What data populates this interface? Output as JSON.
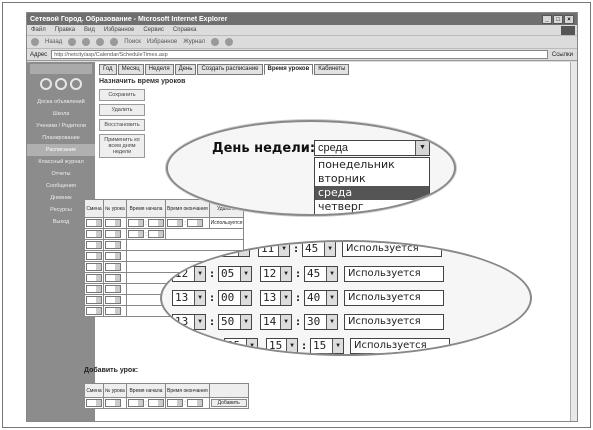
{
  "window": {
    "title": "Сетевой Город. Образование - Microsoft Internet Explorer",
    "controls": [
      "_",
      "□",
      "×"
    ]
  },
  "menubar": [
    "Файл",
    "Правка",
    "Вид",
    "Избранное",
    "Сервис",
    "Справка"
  ],
  "toolbar": [
    "Назад",
    "Поиск",
    "Избранное",
    "Журнал"
  ],
  "address": {
    "label": "Адрес",
    "value": "http://netcity/asp/Calendar/ScheduleTimes.asp",
    "go": "Ссылки"
  },
  "sidebar": {
    "items": [
      "Доска объявлений",
      "Школа",
      "Ученики / Родители",
      "Планирование",
      "Расписание",
      "Классный журнал",
      "Отчеты",
      "Сообщения",
      "Дневник",
      "Ресурсы",
      "Выход"
    ]
  },
  "tabs": [
    "Год",
    "Месяц",
    "Неделя",
    "День",
    "Создать расписание",
    "Время уроков",
    "Кабинеты"
  ],
  "main": {
    "title": "Назначить время уроков",
    "buttons": [
      "Сохранить",
      "Удалить",
      "Восстановить",
      "Применить ко всем дням недели"
    ]
  },
  "dayselect": {
    "label": "День недели:",
    "value": "среда",
    "options": [
      "понедельник",
      "вторник",
      "среда",
      "четверг"
    ]
  },
  "table": {
    "headers": [
      "Смена",
      "№ урока",
      "Время начала",
      "Время окончания",
      "Удалить"
    ],
    "deleteLabel": "Используется"
  },
  "zoomRows": [
    {
      "sh": "12",
      "sm": "05",
      "eh": "12",
      "em": "45",
      "status": "Используется"
    },
    {
      "sh": "13",
      "sm": "00",
      "eh": "13",
      "em": "40",
      "status": "Используется"
    },
    {
      "sh": "13",
      "sm": "50",
      "eh": "14",
      "em": "30",
      "status": "Используется"
    },
    {
      "sh": "",
      "sm": "35",
      "eh": "15",
      "em": "15",
      "status": "Используется"
    }
  ],
  "topZoomRow": {
    "sh": "11",
    "sm": "05",
    "eh": "11",
    "em": "45",
    "status": "Используется"
  },
  "addSection": {
    "title": "Добавить урок:",
    "button": "Добавить"
  }
}
